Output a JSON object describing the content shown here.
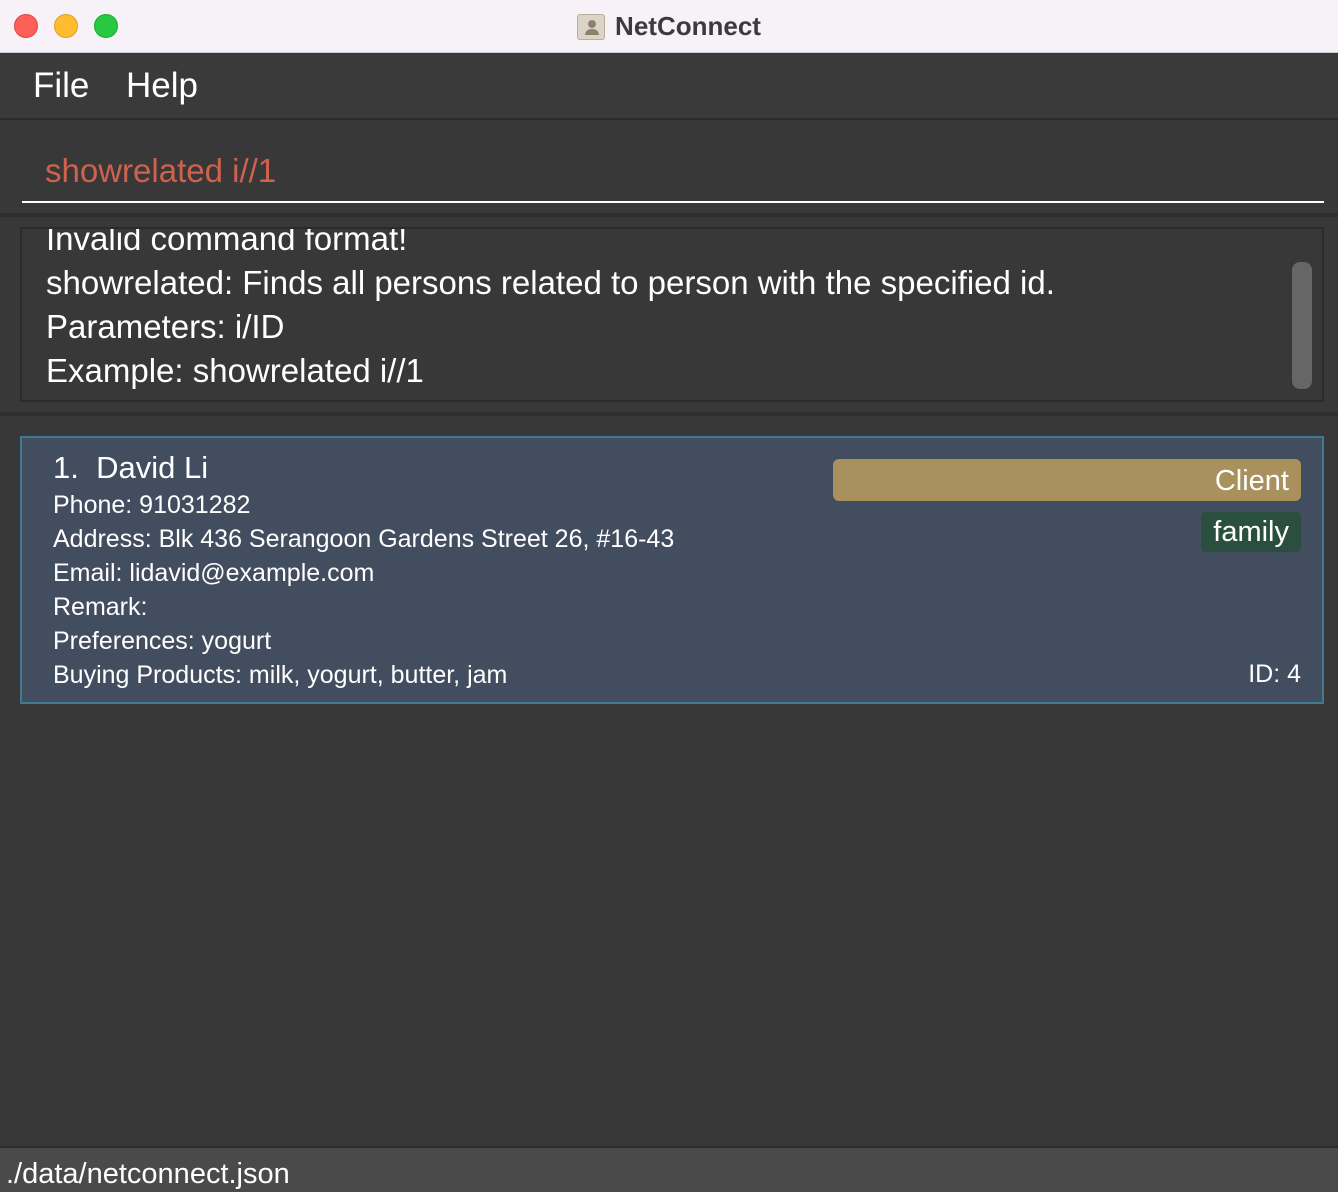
{
  "window": {
    "title": "NetConnect",
    "icon": "address-book-icon"
  },
  "menu": {
    "items": [
      "File",
      "Help"
    ]
  },
  "command": {
    "value": "showrelated i//1",
    "text_color": "#d0614e"
  },
  "result": {
    "lines": [
      "Invalid command format!",
      "showrelated: Finds all persons related to person with the specified id.",
      "Parameters: i/ID",
      "Example: showrelated i//1"
    ]
  },
  "persons": [
    {
      "index": "1.",
      "name": "David Li",
      "phone": "Phone: 91031282",
      "address": "Address: Blk 436 Serangoon Gardens Street 26, #16-43",
      "email": "Email: lidavid@example.com",
      "remark": "Remark:",
      "preferences": "Preferences: yogurt",
      "buying": "Buying Products: milk, yogurt, butter, jam",
      "role_tag": "Client",
      "tag": "family",
      "id": "ID: 4"
    }
  ],
  "status": {
    "file_path": "./data/netconnect.json"
  },
  "colors": {
    "card_background": "#424d5f",
    "card_border": "#3e7b91",
    "client_tag": "#a8915d",
    "family_tag": "#2b4f3e"
  }
}
